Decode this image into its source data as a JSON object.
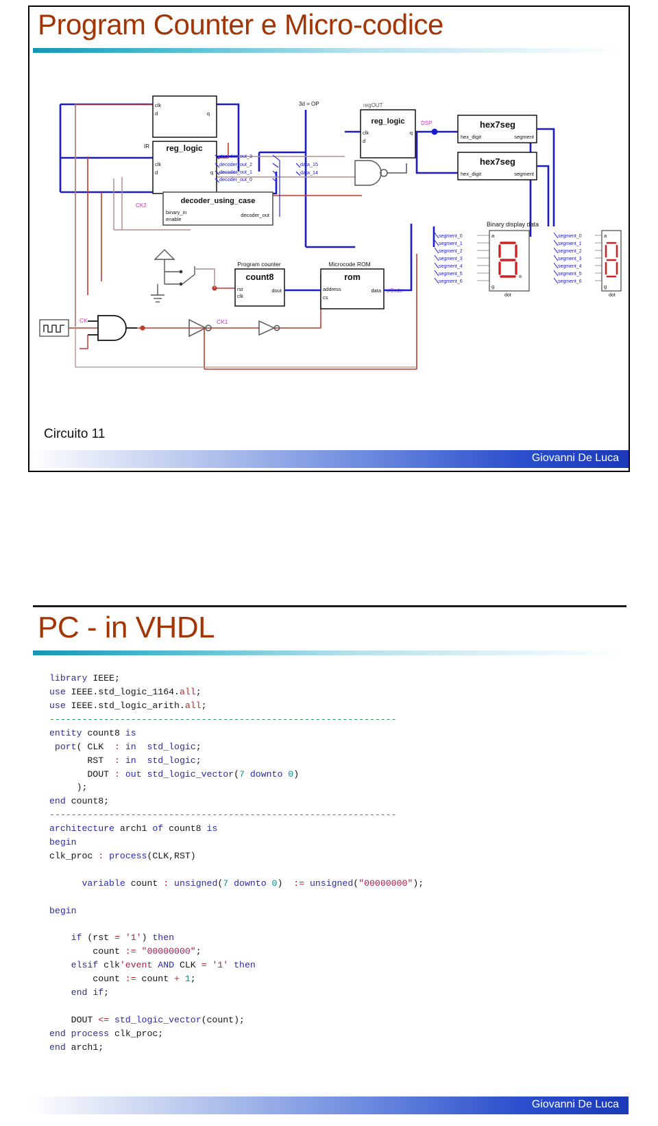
{
  "slides": [
    {
      "title": "Program Counter e Micro-codice",
      "caption": "Circuito 11",
      "footer_name": "Giovanni De Luca"
    },
    {
      "title": "PC - in VHDL",
      "footer_name": "Giovanni De Luca"
    }
  ],
  "colors": {
    "title_brown": "#A33505",
    "rule_teal": "#1596b4",
    "footer_blue": "#2b4fcd",
    "wire_blue": "#1a1ad0",
    "wire_red": "#c0392b",
    "wire_tan": "#b08f8f",
    "label_magenta": "#cc33bb",
    "segment_red": "#cc2222"
  },
  "circuit": {
    "blocks": [
      {
        "id": "reg-top",
        "title": "",
        "instance": "",
        "inputs": [
          "clk",
          "d"
        ],
        "outputs": [
          "q"
        ]
      },
      {
        "id": "reg-ir",
        "title": "reg_logic",
        "instance": "IR",
        "inputs": [
          "clk",
          "d"
        ],
        "outputs": [
          "q"
        ]
      },
      {
        "id": "decoder",
        "title": "decoder_using_case",
        "instance": "",
        "inputs": [
          "binary_in",
          "enable"
        ],
        "outputs": [
          "decoder_out"
        ]
      },
      {
        "id": "reg-out",
        "title": "reg_logic",
        "instance": "regOUT",
        "inputs": [
          "clk",
          "d"
        ],
        "outputs": [
          "q"
        ]
      },
      {
        "id": "hex7seg-1",
        "title": "hex7seg",
        "instance": "",
        "inputs": [
          "hex_digit"
        ],
        "outputs": [
          "segment"
        ]
      },
      {
        "id": "hex7seg-2",
        "title": "hex7seg",
        "instance": "",
        "inputs": [
          "hex_digit"
        ],
        "outputs": [
          "segment"
        ]
      },
      {
        "id": "program-counter",
        "title": "count8",
        "instance": "Program counter",
        "inputs": [
          "rst",
          "clk"
        ],
        "outputs": [
          "dout"
        ]
      },
      {
        "id": "microcode-rom",
        "title": "rom",
        "instance": "Microcode ROM",
        "inputs": [
          "address",
          "cs"
        ],
        "outputs": [
          "data"
        ]
      }
    ],
    "net_labels": [
      "decoder_out_3",
      "decoder_out_2",
      "decoder_out_1",
      "decoder_out_0",
      "data_15",
      "data_14",
      "segment_0",
      "segment_1",
      "segment_2",
      "segment_3",
      "segment_4",
      "segment_5",
      "segment_6"
    ],
    "annotations": {
      "op_note": "3d = OP",
      "display_note": "Binary display data",
      "dsp_label": "DSP",
      "ucode_label": "uCode",
      "clk_label": "CK",
      "clk1_label": "CK1",
      "clk2_label": "CK2"
    },
    "display_pins": {
      "top": "a",
      "bottom": "g",
      "dot": "dot"
    }
  },
  "code": {
    "lines": [
      [
        [
          "kw",
          "library"
        ],
        [
          "id",
          " IEEE;"
        ]
      ],
      [
        [
          "kw",
          "use"
        ],
        [
          "id",
          " IEEE.std_logic_1164."
        ],
        [
          "op",
          "all"
        ],
        [
          "id",
          ";"
        ]
      ],
      [
        [
          "kw",
          "use"
        ],
        [
          "id",
          " IEEE.std_logic_arith."
        ],
        [
          "op",
          "all"
        ],
        [
          "id",
          ";"
        ]
      ],
      [
        [
          "cmt",
          "----------------------------------------------------------------"
        ]
      ],
      [
        [
          "kw",
          "entity"
        ],
        [
          "id",
          " count8 "
        ],
        [
          "kw",
          "is"
        ]
      ],
      [
        [
          "id",
          " "
        ],
        [
          "kw",
          "port"
        ],
        [
          "id",
          "( CLK  "
        ],
        [
          "op",
          ":"
        ],
        [
          "id",
          " "
        ],
        [
          "kw",
          "in"
        ],
        [
          "id",
          "  "
        ],
        [
          "type",
          "std_logic"
        ],
        [
          "id",
          ";"
        ]
      ],
      [
        [
          "id",
          "       RST  "
        ],
        [
          "op",
          ":"
        ],
        [
          "id",
          " "
        ],
        [
          "kw",
          "in"
        ],
        [
          "id",
          "  "
        ],
        [
          "type",
          "std_logic"
        ],
        [
          "id",
          ";"
        ]
      ],
      [
        [
          "id",
          "       DOUT "
        ],
        [
          "op",
          ":"
        ],
        [
          "id",
          " "
        ],
        [
          "kw",
          "out"
        ],
        [
          "id",
          " "
        ],
        [
          "type",
          "std_logic_vector"
        ],
        [
          "id",
          "("
        ],
        [
          "num",
          "7"
        ],
        [
          "id",
          " "
        ],
        [
          "kw",
          "downto"
        ],
        [
          "id",
          " "
        ],
        [
          "num",
          "0"
        ],
        [
          "id",
          ")"
        ]
      ],
      [
        [
          "id",
          "     );"
        ]
      ],
      [
        [
          "kw",
          "end"
        ],
        [
          "id",
          " count8;"
        ]
      ],
      [
        [
          "cmt",
          "----------------------------------------------------------------"
        ]
      ],
      [
        [
          "kw",
          "architecture"
        ],
        [
          "id",
          " arch1 "
        ],
        [
          "kw",
          "of"
        ],
        [
          "id",
          " count8 "
        ],
        [
          "kw",
          "is"
        ]
      ],
      [
        [
          "kw",
          "begin"
        ]
      ],
      [
        [
          "id",
          "clk_proc "
        ],
        [
          "op",
          ":"
        ],
        [
          "id",
          " "
        ],
        [
          "kw",
          "process"
        ],
        [
          "id",
          "(CLK,RST)"
        ]
      ],
      [],
      [
        [
          "id",
          "      "
        ],
        [
          "kw",
          "variable"
        ],
        [
          "id",
          " count "
        ],
        [
          "op",
          ":"
        ],
        [
          "id",
          " "
        ],
        [
          "type",
          "unsigned"
        ],
        [
          "id",
          "("
        ],
        [
          "num",
          "7"
        ],
        [
          "id",
          " "
        ],
        [
          "kw",
          "downto"
        ],
        [
          "id",
          " "
        ],
        [
          "num",
          "0"
        ],
        [
          "id",
          ")  "
        ],
        [
          "op",
          ":="
        ],
        [
          "id",
          " "
        ],
        [
          "type",
          "unsigned"
        ],
        [
          "id",
          "("
        ],
        [
          "str",
          "\"00000000\""
        ],
        [
          "id",
          ");"
        ]
      ],
      [],
      [
        [
          "kw",
          "begin"
        ]
      ],
      [],
      [
        [
          "id",
          "    "
        ],
        [
          "kw",
          "if"
        ],
        [
          "id",
          " (rst "
        ],
        [
          "op",
          "="
        ],
        [
          "id",
          " "
        ],
        [
          "str",
          "'1'"
        ],
        [
          "id",
          ") "
        ],
        [
          "kw",
          "then"
        ]
      ],
      [
        [
          "id",
          "        count "
        ],
        [
          "op",
          ":="
        ],
        [
          "id",
          " "
        ],
        [
          "str",
          "\"00000000\""
        ],
        [
          "id",
          ";"
        ]
      ],
      [
        [
          "id",
          "    "
        ],
        [
          "kw",
          "elsif"
        ],
        [
          "id",
          " clk"
        ],
        [
          "str",
          "'event"
        ],
        [
          "id",
          " "
        ],
        [
          "kw",
          "AND"
        ],
        [
          "id",
          " CLK "
        ],
        [
          "op",
          "="
        ],
        [
          "id",
          " "
        ],
        [
          "str",
          "'1'"
        ],
        [
          "id",
          " "
        ],
        [
          "kw",
          "then"
        ]
      ],
      [
        [
          "id",
          "        count "
        ],
        [
          "op",
          ":="
        ],
        [
          "id",
          " count "
        ],
        [
          "op",
          "+"
        ],
        [
          "id",
          " "
        ],
        [
          "num",
          "1"
        ],
        [
          "id",
          ";"
        ]
      ],
      [
        [
          "id",
          "    "
        ],
        [
          "kw",
          "end"
        ],
        [
          "id",
          " "
        ],
        [
          "kw",
          "if"
        ],
        [
          "id",
          ";"
        ]
      ],
      [],
      [
        [
          "id",
          "    DOUT "
        ],
        [
          "op",
          "<="
        ],
        [
          "id",
          " "
        ],
        [
          "type",
          "std_logic_vector"
        ],
        [
          "id",
          "(count);"
        ]
      ],
      [
        [
          "kw",
          "end"
        ],
        [
          "id",
          " "
        ],
        [
          "kw",
          "process"
        ],
        [
          "id",
          " clk_proc;"
        ]
      ],
      [
        [
          "kw",
          "end"
        ],
        [
          "id",
          " arch1;"
        ]
      ]
    ]
  }
}
